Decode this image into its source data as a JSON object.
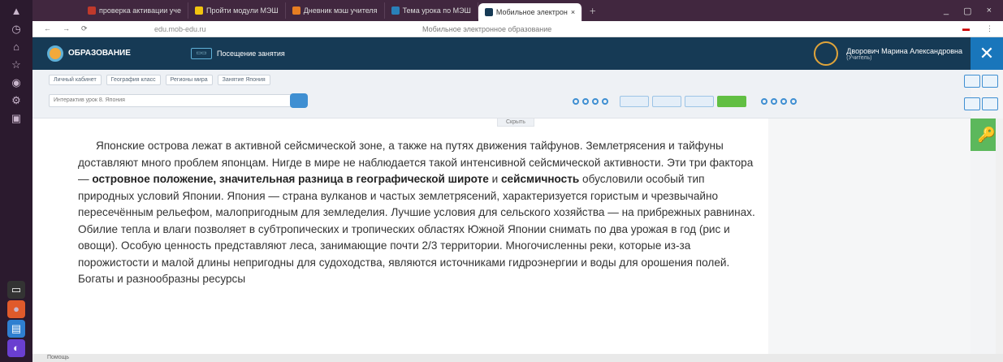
{
  "browser": {
    "tabs": [
      {
        "label": "проверка активации уче"
      },
      {
        "label": "Пройти модули МЭШ"
      },
      {
        "label": "Дневник мэш учителя"
      },
      {
        "label": "Тема урока по МЭШ"
      },
      {
        "label": "Мобильное электрон",
        "active": true
      }
    ],
    "page_title": "Мобильное электронное образование",
    "url": "edu.mob-edu.ru",
    "window_controls": [
      "_",
      "▢",
      "×"
    ]
  },
  "app": {
    "logo_text": "ОБРАЗОВАНИЕ",
    "lesson_button": "Посещение занятия",
    "user_name": "Дворович Марина Александровна",
    "user_role": "(Учитель)",
    "close_icon": "close-icon",
    "accent_color": "#163a55",
    "active_color": "#5cb85c"
  },
  "breadcrumbs": [
    "Личный кабинет",
    "География класс",
    "Регионы мира",
    "Занятие Япония"
  ],
  "lesson_select": {
    "value": "Интерактив урок 8. Япония"
  },
  "hide_label": "Скрыть",
  "text": {
    "p1_a": "Японские острова лежат в активной сейсмической зоне, а также на путях движения тайфунов. Землетрясения и тайфуны доставляют много проблем японцам. Нигде в мире не наблюдается такой интенсивной сейсмической активности. Эти три фактора — ",
    "p1_bold1": "островное положение, значительная разница в географической широте",
    "p1_b": " и ",
    "p1_bold2": "сейсмичность",
    "p1_c": " обусловили особый тип природных условий Японии. Япония — страна вулканов и частых землетрясений, характеризуется гористым и чрезвычайно пересечённым рельефом, малопригодным для земледелия. Лучшие условия для сельского хозяйства — на прибрежных равнинах. Обилие тепла и влаги позволяет в субтропических и тропических областях Южной Японии снимать по два урожая в год (рис и овощи). Особую ценность представляют леса, занимающие почти 2/3 территории. Многочисленны реки, которые из-за порожистости и малой длины непригодны для судоходства, являются источниками гидроэнергии и воды для орошения полей. Богаты и разнообразны ресурсы"
  },
  "status": {
    "text": "Помощь"
  }
}
